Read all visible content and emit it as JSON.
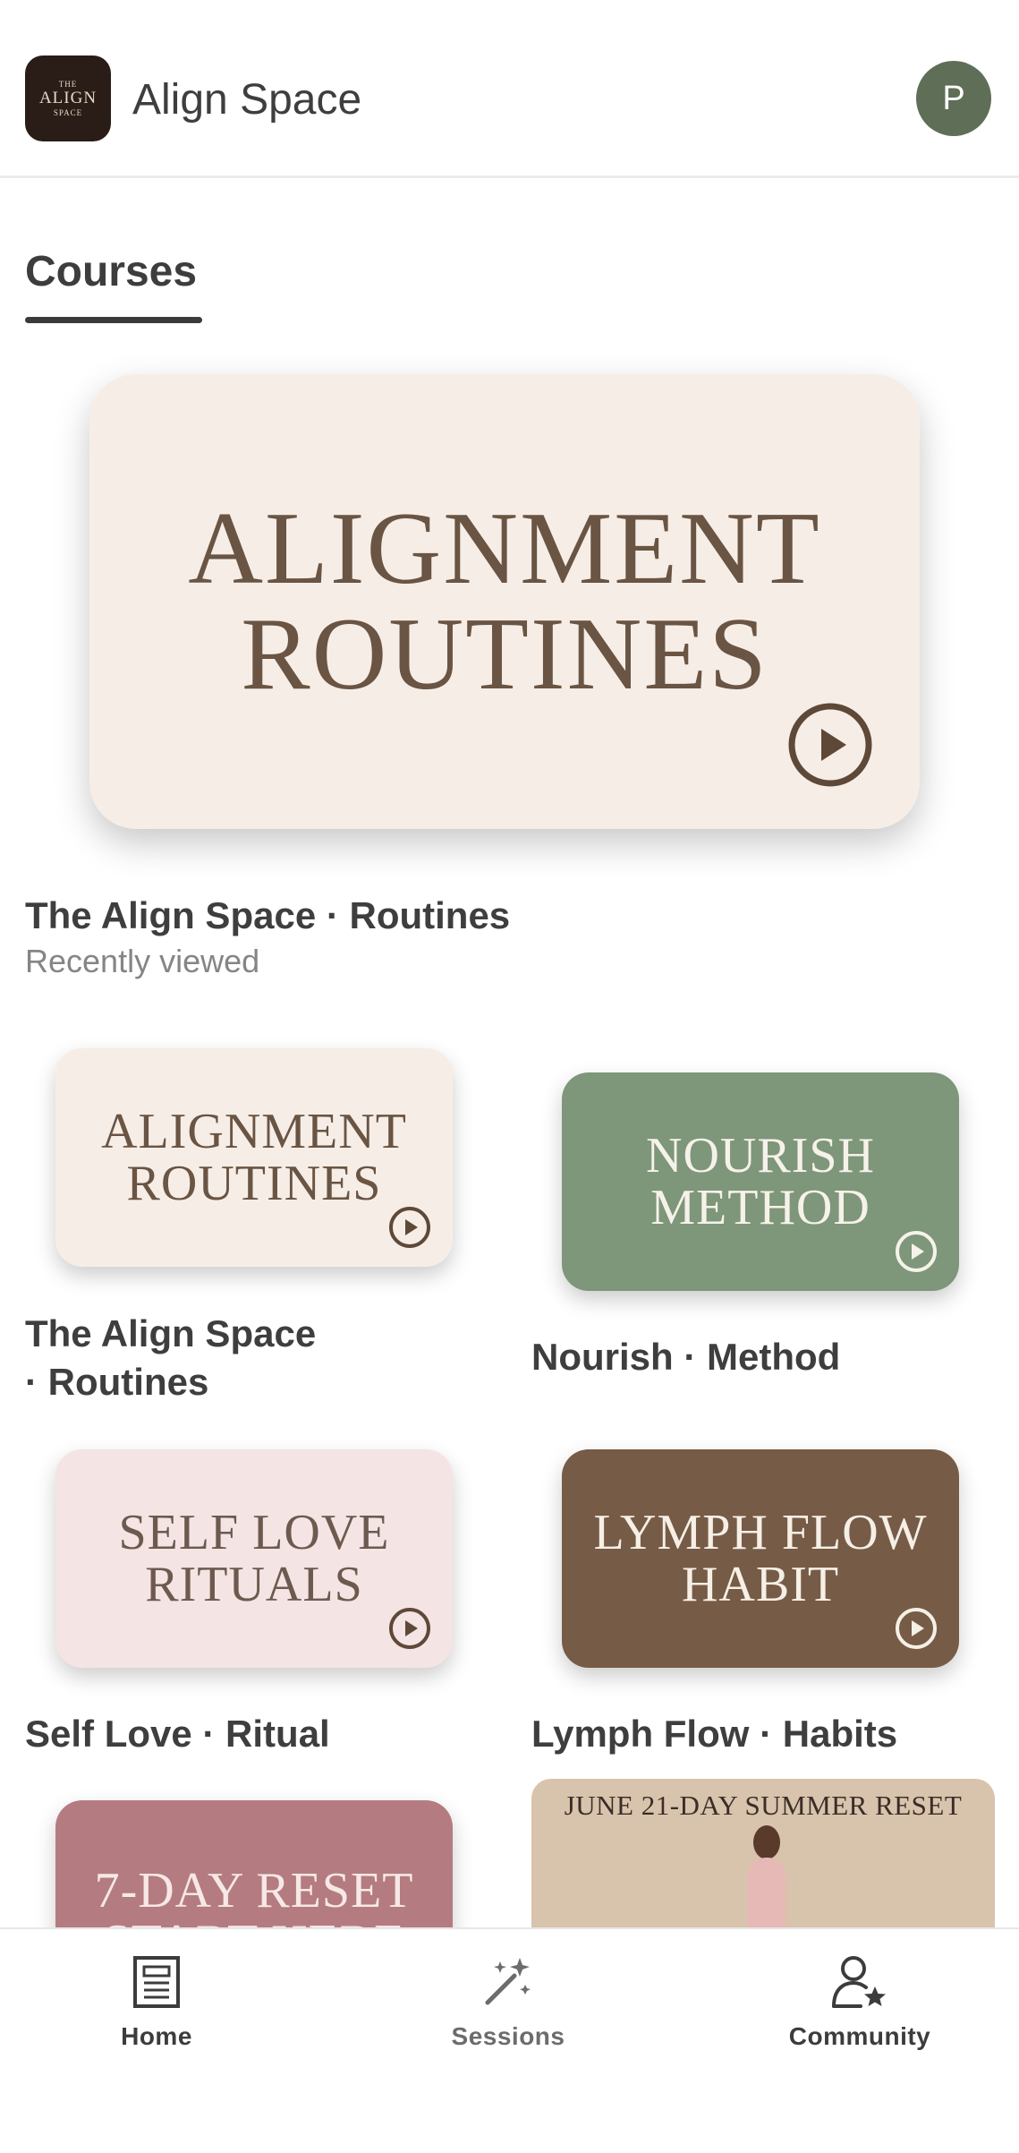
{
  "header": {
    "logo_lines": [
      "THE",
      "ALIGN",
      "SPACE"
    ],
    "title": "Align Space",
    "avatar_initial": "P"
  },
  "tabs": [
    {
      "label": "Courses",
      "active": true
    }
  ],
  "featured": {
    "thumbnail_lines": [
      "ALIGNMENT",
      "ROUTINES"
    ],
    "title": "The Align Space · Routines",
    "subtitle": "Recently viewed"
  },
  "courses": [
    {
      "thumbnail_lines": [
        "ALIGNMENT",
        "ROUTINES"
      ],
      "title_lines": [
        "The Align Space",
        "· Routines"
      ],
      "color": "#f6eee6"
    },
    {
      "thumbnail_lines": [
        "NOURISH",
        "METHOD"
      ],
      "title": "Nourish · Method",
      "color": "#7e9679"
    },
    {
      "thumbnail_lines": [
        "SELF LOVE",
        "RITUALS"
      ],
      "title": "Self Love · Ritual",
      "color": "#f4e4e4"
    },
    {
      "thumbnail_lines": [
        "LYMPH FLOW",
        "HABIT"
      ],
      "title": "Lymph Flow · Habits",
      "color": "#765b46"
    },
    {
      "thumbnail_lines": [
        "7-DAY RESET",
        "START HERE"
      ],
      "color": "#b47c80"
    },
    {
      "thumbnail_text": "JUNE 21-DAY SUMMER RESET",
      "color": "#d8c3ad"
    }
  ],
  "bottom_nav": [
    {
      "label": "Home",
      "icon": "document-icon",
      "active": true
    },
    {
      "label": "Sessions",
      "icon": "magic-wand-icon",
      "active": false
    },
    {
      "label": "Community",
      "icon": "user-star-icon",
      "active": false
    }
  ],
  "play_icon": "play-circle-icon"
}
